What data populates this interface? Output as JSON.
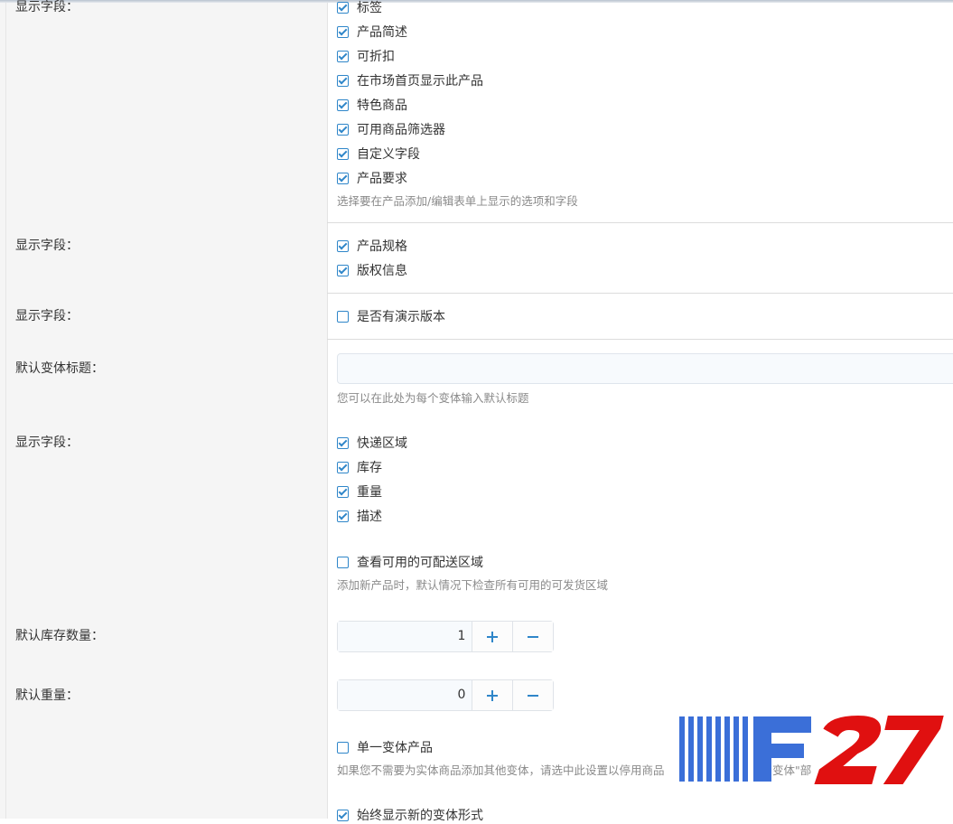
{
  "colors": {
    "accent": "#2f86c9",
    "logo_blue": "#3b6fd8",
    "logo_red": "#e01010"
  },
  "section1": {
    "label": "显示字段：",
    "items": [
      {
        "label": "标签",
        "checked": true
      },
      {
        "label": "产品简述",
        "checked": true
      },
      {
        "label": "可折扣",
        "checked": true
      },
      {
        "label": "在市场首页显示此产品",
        "checked": true
      },
      {
        "label": "特色商品",
        "checked": true
      },
      {
        "label": "可用商品筛选器",
        "checked": true
      },
      {
        "label": "自定义字段",
        "checked": true
      },
      {
        "label": "产品要求",
        "checked": true
      }
    ],
    "hint": "选择要在产品添加/编辑表单上显示的选项和字段"
  },
  "section2": {
    "label": "显示字段：",
    "items": [
      {
        "label": "产品规格",
        "checked": true
      },
      {
        "label": "版权信息",
        "checked": true
      }
    ]
  },
  "section3": {
    "label": "显示字段：",
    "items": [
      {
        "label": "是否有演示版本",
        "checked": false
      }
    ]
  },
  "section4": {
    "label": "默认变体标题：",
    "input_value": "",
    "hint": "您可以在此处为每个变体输入默认标题"
  },
  "section5": {
    "label": "显示字段：",
    "items": [
      {
        "label": "快递区域",
        "checked": true
      },
      {
        "label": "库存",
        "checked": true
      },
      {
        "label": "重量",
        "checked": true
      },
      {
        "label": "描述",
        "checked": true
      }
    ],
    "extra": {
      "label": "查看可用的可配送区域",
      "checked": false
    },
    "hint": "添加新产品时，默认情况下检查所有可用的可发货区域"
  },
  "section6": {
    "label": "默认库存数量：",
    "value": "1"
  },
  "section7": {
    "label": "默认重量：",
    "value": "0"
  },
  "section8": {
    "single": {
      "label": "单一变体产品",
      "checked": false
    },
    "hint": "如果您不需要为实体商品添加其他变体，请选中此设置以停用商品",
    "hint_tail": "变体\"部",
    "always": {
      "label": "始终显示新的变体形式",
      "checked": true
    }
  },
  "logo": {
    "text": "F27"
  }
}
